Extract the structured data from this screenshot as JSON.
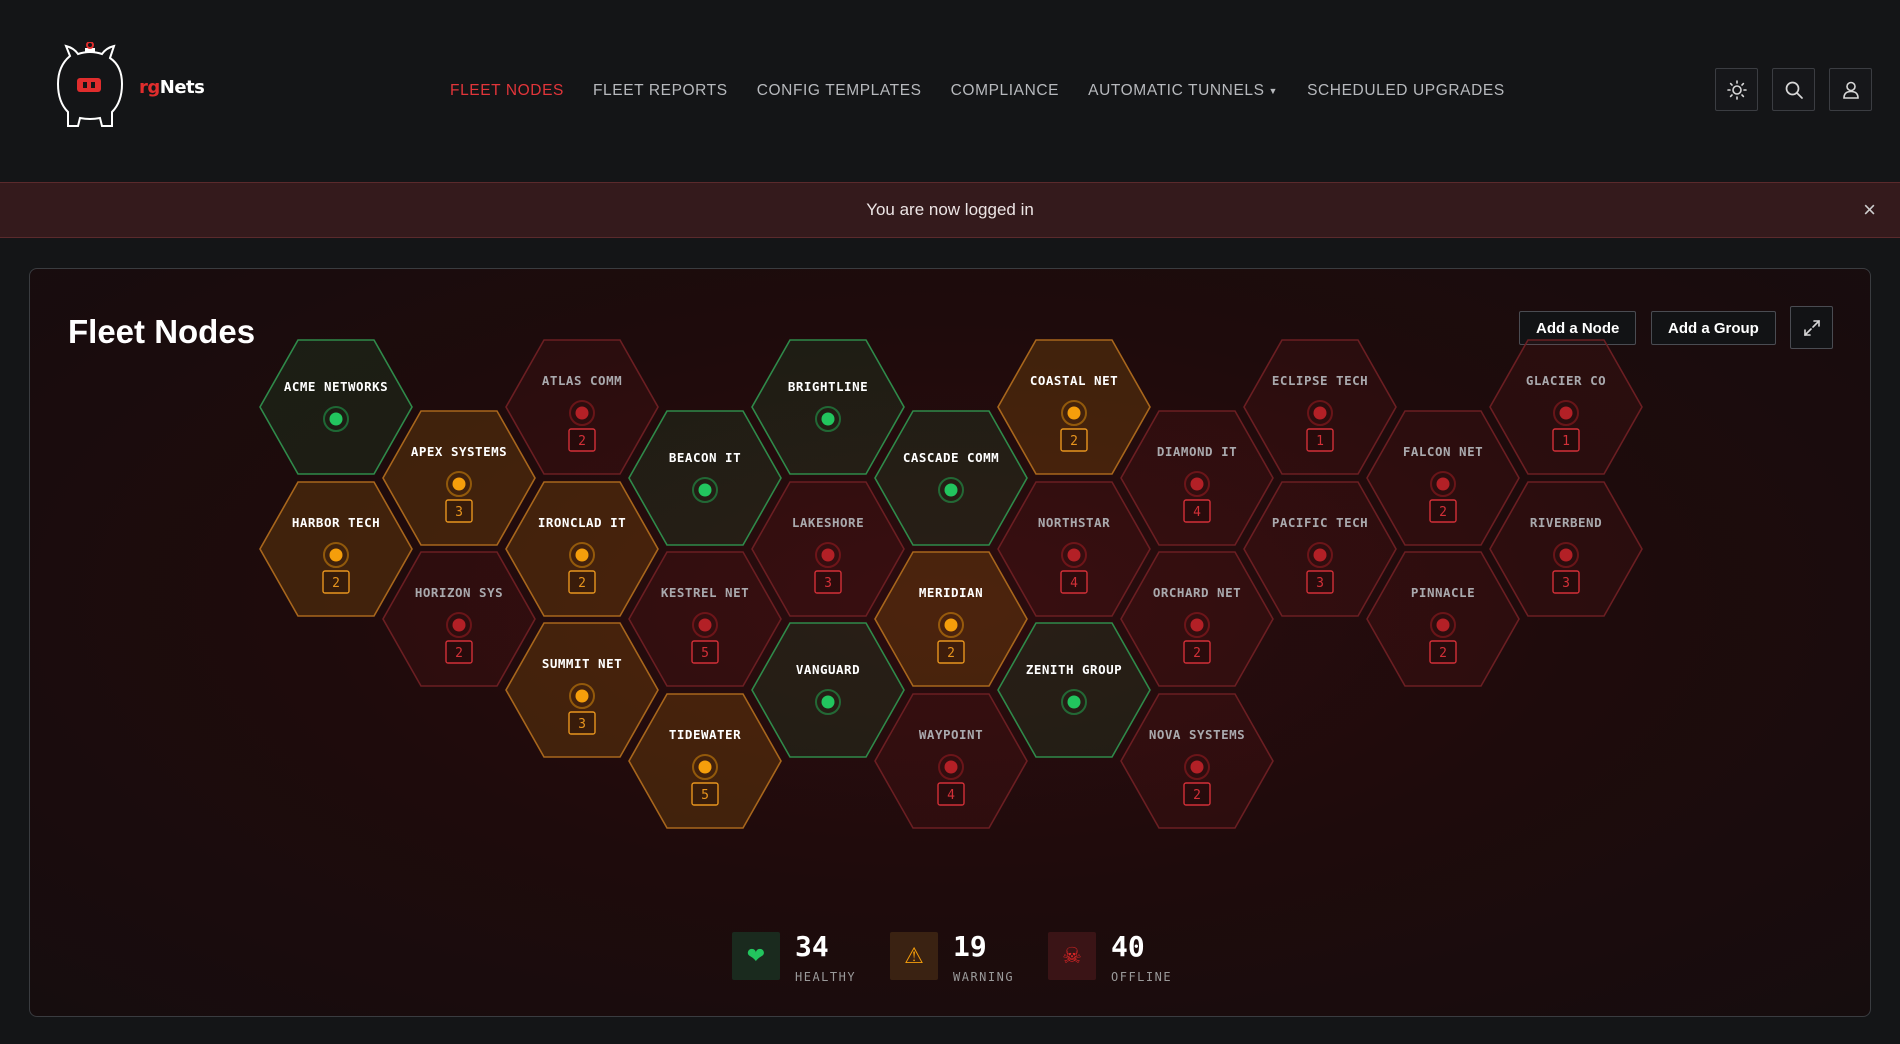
{
  "brand": {
    "prefix": "rg",
    "suffix": "Nets"
  },
  "nav": [
    {
      "label": "FLEET NODES",
      "active": true
    },
    {
      "label": "FLEET REPORTS"
    },
    {
      "label": "CONFIG TEMPLATES"
    },
    {
      "label": "COMPLIANCE"
    },
    {
      "label": "AUTOMATIC TUNNELS",
      "dropdown": true
    },
    {
      "label": "SCHEDULED UPGRADES"
    }
  ],
  "alert": {
    "message": "You are now logged in",
    "close": "×"
  },
  "page": {
    "title": "Fleet Nodes",
    "add_node": "Add a Node",
    "add_group": "Add a Group"
  },
  "colors": {
    "healthy": "#22c55e",
    "warning": "#f59e0b",
    "offline": "#dc2626",
    "accent": "#e2353a"
  },
  "nodes": [
    {
      "name": "ACME NETWORKS",
      "status": "healthy"
    },
    {
      "name": "HARBOR TECH",
      "status": "warning",
      "count": 2
    },
    {
      "name": "APEX SYSTEMS",
      "status": "warning",
      "count": 3
    },
    {
      "name": "HORIZON SYS",
      "status": "offline",
      "count": 2
    },
    {
      "name": "ATLAS COMM",
      "status": "offline",
      "count": 2
    },
    {
      "name": "IRONCLAD IT",
      "status": "warning",
      "count": 2
    },
    {
      "name": "SUMMIT NET",
      "status": "warning",
      "count": 3
    },
    {
      "name": "BEACON IT",
      "status": "healthy"
    },
    {
      "name": "KESTREL NET",
      "status": "offline",
      "count": 5
    },
    {
      "name": "TIDEWATER",
      "status": "warning",
      "count": 5
    },
    {
      "name": "BRIGHTLINE",
      "status": "healthy"
    },
    {
      "name": "LAKESHORE",
      "status": "offline",
      "count": 3
    },
    {
      "name": "VANGUARD",
      "status": "healthy"
    },
    {
      "name": "CASCADE COMM",
      "status": "healthy"
    },
    {
      "name": "MERIDIAN",
      "status": "warning",
      "count": 2
    },
    {
      "name": "WAYPOINT",
      "status": "offline",
      "count": 4
    },
    {
      "name": "COASTAL NET",
      "status": "warning",
      "count": 2
    },
    {
      "name": "NORTHSTAR",
      "status": "offline",
      "count": 4
    },
    {
      "name": "ZENITH GROUP",
      "status": "healthy"
    },
    {
      "name": "DIAMOND IT",
      "status": "offline",
      "count": 4
    },
    {
      "name": "ORCHARD NET",
      "status": "offline",
      "count": 2
    },
    {
      "name": "NOVA SYSTEMS",
      "status": "offline",
      "count": 2
    },
    {
      "name": "ECLIPSE TECH",
      "status": "offline",
      "count": 1
    },
    {
      "name": "PACIFIC TECH",
      "status": "offline",
      "count": 3
    },
    {
      "name": "FALCON NET",
      "status": "offline",
      "count": 2
    },
    {
      "name": "PINNACLE",
      "status": "offline",
      "count": 2
    },
    {
      "name": "GLACIER CO",
      "status": "offline",
      "count": 1
    },
    {
      "name": "RIVERBEND",
      "status": "offline",
      "count": 3
    }
  ],
  "stats": {
    "healthy": {
      "value": "34",
      "label": "HEALTHY",
      "icon": "heart-icon"
    },
    "warning": {
      "value": "19",
      "label": "WARNING",
      "icon": "warning-icon"
    },
    "offline": {
      "value": "40",
      "label": "OFFLINE",
      "icon": "skull-icon"
    }
  }
}
